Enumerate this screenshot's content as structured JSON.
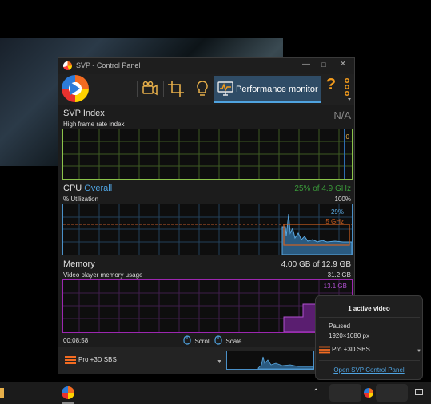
{
  "window": {
    "title": "SVP - Control Panel"
  },
  "toolbar": {
    "active_tab": "Performance monitor",
    "help": "?"
  },
  "svp_index": {
    "title": "SVP Index",
    "value": "N/A",
    "subtitle": "High frame rate index",
    "graph_value": "0"
  },
  "cpu": {
    "title": "CPU",
    "link": "Overall",
    "value": "25% of 4.9 GHz",
    "subtitle": "% Utilization",
    "max": "100%",
    "graph_label_1": "29%",
    "graph_label_2": "5 GHz"
  },
  "memory": {
    "title": "Memory",
    "value": "4.00 GB of 12.9 GB",
    "subtitle": "Video player memory usage",
    "max": "31.2 GB",
    "graph_label": "13.1 GB"
  },
  "statusbar": {
    "time": "00:08:58",
    "scroll": "Scroll",
    "scale": "Scale"
  },
  "bottombar": {
    "profile": "Pro +3D SBS"
  },
  "popup": {
    "title": "1 active video",
    "state": "Paused",
    "resolution": "1920×1080 px",
    "profile": "Pro +3D SBS",
    "link": "Open SVP Control Panel"
  },
  "colors": {
    "svp_index": "#8bc34a",
    "cpu": "#4a90c8",
    "memory": "#9c27b0",
    "accent": "#4fa3e0",
    "orange": "#f39b1c"
  },
  "icons": [
    "video-icon",
    "crop-icon",
    "lightbulb-icon",
    "monitor-icon",
    "help-icon",
    "more-icon",
    "profile-icon",
    "mouse-icon",
    "chevron-down-icon"
  ]
}
